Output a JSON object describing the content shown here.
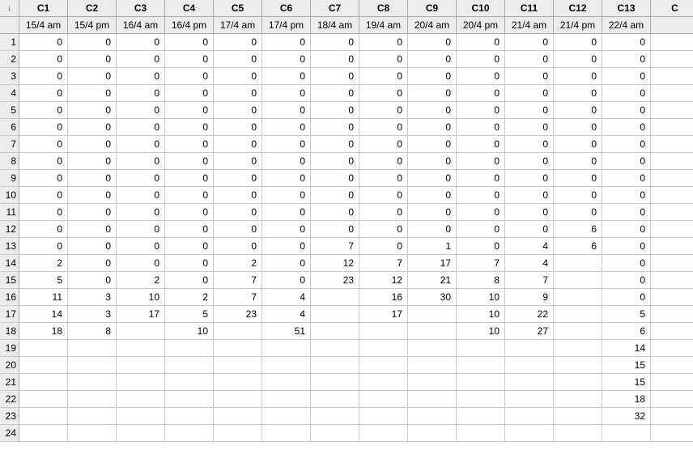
{
  "corner_arrow": "↓",
  "columns": [
    {
      "id": "C1",
      "label": "15/4 am"
    },
    {
      "id": "C2",
      "label": "15/4 pm"
    },
    {
      "id": "C3",
      "label": "16/4 am"
    },
    {
      "id": "C4",
      "label": "16/4 pm"
    },
    {
      "id": "C5",
      "label": "17/4 am"
    },
    {
      "id": "C6",
      "label": "17/4 pm"
    },
    {
      "id": "C7",
      "label": "18/4 am"
    },
    {
      "id": "C8",
      "label": "19/4 am"
    },
    {
      "id": "C9",
      "label": "20/4 am"
    },
    {
      "id": "C10",
      "label": "20/4 pm"
    },
    {
      "id": "C11",
      "label": "21/4 am"
    },
    {
      "id": "C12",
      "label": "21/4 pm"
    },
    {
      "id": "C13",
      "label": "22/4 am"
    },
    {
      "id": "C",
      "label": ""
    }
  ],
  "rows": [
    {
      "n": "1",
      "v": [
        "0",
        "0",
        "0",
        "0",
        "0",
        "0",
        "0",
        "0",
        "0",
        "0",
        "0",
        "0",
        "0",
        ""
      ]
    },
    {
      "n": "2",
      "v": [
        "0",
        "0",
        "0",
        "0",
        "0",
        "0",
        "0",
        "0",
        "0",
        "0",
        "0",
        "0",
        "0",
        ""
      ]
    },
    {
      "n": "3",
      "v": [
        "0",
        "0",
        "0",
        "0",
        "0",
        "0",
        "0",
        "0",
        "0",
        "0",
        "0",
        "0",
        "0",
        ""
      ]
    },
    {
      "n": "4",
      "v": [
        "0",
        "0",
        "0",
        "0",
        "0",
        "0",
        "0",
        "0",
        "0",
        "0",
        "0",
        "0",
        "0",
        ""
      ]
    },
    {
      "n": "5",
      "v": [
        "0",
        "0",
        "0",
        "0",
        "0",
        "0",
        "0",
        "0",
        "0",
        "0",
        "0",
        "0",
        "0",
        ""
      ]
    },
    {
      "n": "6",
      "v": [
        "0",
        "0",
        "0",
        "0",
        "0",
        "0",
        "0",
        "0",
        "0",
        "0",
        "0",
        "0",
        "0",
        ""
      ]
    },
    {
      "n": "7",
      "v": [
        "0",
        "0",
        "0",
        "0",
        "0",
        "0",
        "0",
        "0",
        "0",
        "0",
        "0",
        "0",
        "0",
        ""
      ]
    },
    {
      "n": "8",
      "v": [
        "0",
        "0",
        "0",
        "0",
        "0",
        "0",
        "0",
        "0",
        "0",
        "0",
        "0",
        "0",
        "0",
        ""
      ]
    },
    {
      "n": "9",
      "v": [
        "0",
        "0",
        "0",
        "0",
        "0",
        "0",
        "0",
        "0",
        "0",
        "0",
        "0",
        "0",
        "0",
        ""
      ]
    },
    {
      "n": "10",
      "v": [
        "0",
        "0",
        "0",
        "0",
        "0",
        "0",
        "0",
        "0",
        "0",
        "0",
        "0",
        "0",
        "0",
        ""
      ]
    },
    {
      "n": "11",
      "v": [
        "0",
        "0",
        "0",
        "0",
        "0",
        "0",
        "0",
        "0",
        "0",
        "0",
        "0",
        "0",
        "0",
        ""
      ]
    },
    {
      "n": "12",
      "v": [
        "0",
        "0",
        "0",
        "0",
        "0",
        "0",
        "0",
        "0",
        "0",
        "0",
        "0",
        "6",
        "0",
        ""
      ]
    },
    {
      "n": "13",
      "v": [
        "0",
        "0",
        "0",
        "0",
        "0",
        "0",
        "7",
        "0",
        "1",
        "0",
        "4",
        "6",
        "0",
        ""
      ]
    },
    {
      "n": "14",
      "v": [
        "2",
        "0",
        "0",
        "0",
        "2",
        "0",
        "12",
        "7",
        "17",
        "7",
        "4",
        "",
        "0",
        ""
      ]
    },
    {
      "n": "15",
      "v": [
        "5",
        "0",
        "2",
        "0",
        "7",
        "0",
        "23",
        "12",
        "21",
        "8",
        "7",
        "",
        "0",
        ""
      ]
    },
    {
      "n": "16",
      "v": [
        "11",
        "3",
        "10",
        "2",
        "7",
        "4",
        "",
        "16",
        "30",
        "10",
        "9",
        "",
        "0",
        ""
      ]
    },
    {
      "n": "17",
      "v": [
        "14",
        "3",
        "17",
        "5",
        "23",
        "4",
        "",
        "17",
        "",
        "10",
        "22",
        "",
        "5",
        ""
      ]
    },
    {
      "n": "18",
      "v": [
        "18",
        "8",
        "",
        "10",
        "",
        "51",
        "",
        "",
        "",
        "10",
        "27",
        "",
        "6",
        ""
      ]
    },
    {
      "n": "19",
      "v": [
        "",
        "",
        "",
        "",
        "",
        "",
        "",
        "",
        "",
        "",
        "",
        "",
        "14",
        ""
      ]
    },
    {
      "n": "20",
      "v": [
        "",
        "",
        "",
        "",
        "",
        "",
        "",
        "",
        "",
        "",
        "",
        "",
        "15",
        ""
      ]
    },
    {
      "n": "21",
      "v": [
        "",
        "",
        "",
        "",
        "",
        "",
        "",
        "",
        "",
        "",
        "",
        "",
        "15",
        ""
      ]
    },
    {
      "n": "22",
      "v": [
        "",
        "",
        "",
        "",
        "",
        "",
        "",
        "",
        "",
        "",
        "",
        "",
        "18",
        ""
      ]
    },
    {
      "n": "23",
      "v": [
        "",
        "",
        "",
        "",
        "",
        "",
        "",
        "",
        "",
        "",
        "",
        "",
        "32",
        ""
      ]
    },
    {
      "n": "24",
      "v": [
        "",
        "",
        "",
        "",
        "",
        "",
        "",
        "",
        "",
        "",
        "",
        "",
        "",
        ""
      ]
    }
  ]
}
